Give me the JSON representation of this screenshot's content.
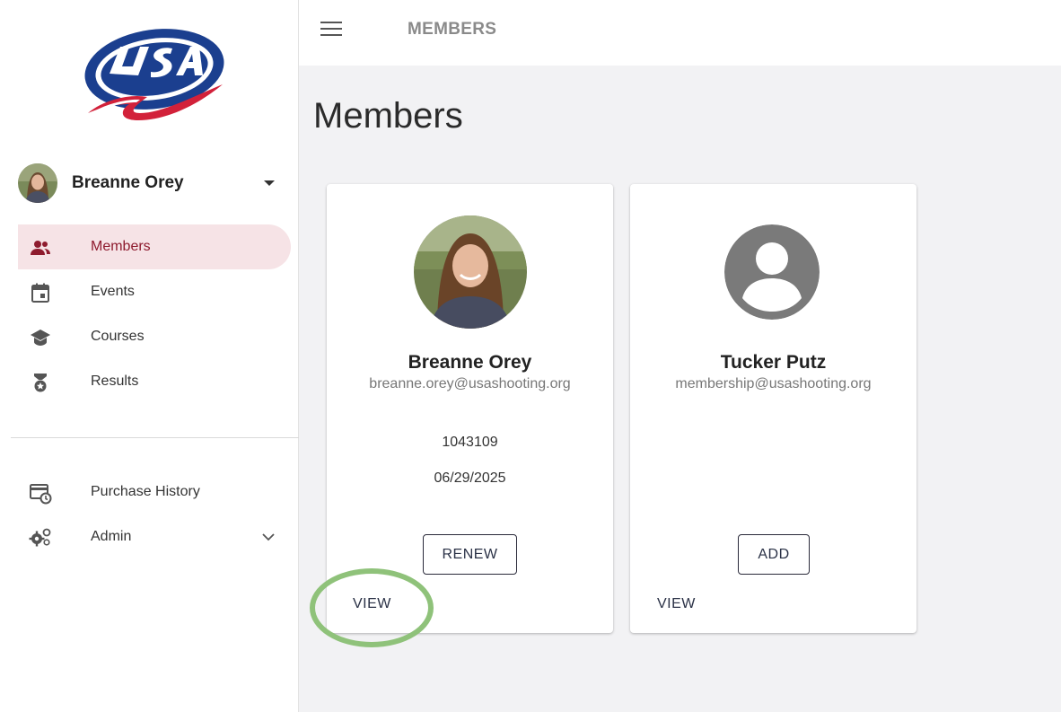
{
  "brand": {
    "logo_alt": "USA Shooting"
  },
  "user": {
    "name": "Breanne Orey"
  },
  "sidebar": {
    "items": [
      {
        "label": "Members",
        "icon": "people-icon",
        "active": true
      },
      {
        "label": "Events",
        "icon": "calendar-icon"
      },
      {
        "label": "Courses",
        "icon": "graduation-cap-icon"
      },
      {
        "label": "Results",
        "icon": "medal-icon"
      }
    ],
    "secondary": [
      {
        "label": "Purchase History",
        "icon": "purchase-history-icon"
      },
      {
        "label": "Admin",
        "icon": "gears-icon"
      }
    ]
  },
  "topbar": {
    "title": "MEMBERS"
  },
  "page": {
    "title": "Members"
  },
  "members": [
    {
      "name": "Breanne Orey",
      "email": "breanne.orey@usashooting.org",
      "member_id": "1043109",
      "expiration": "06/29/2025",
      "primary_action": "RENEW",
      "secondary_action": "VIEW"
    },
    {
      "name": "Tucker Putz",
      "email": "membership@usashooting.org",
      "primary_action": "ADD",
      "secondary_action": "VIEW"
    }
  ],
  "colors": {
    "accent": "#8e1b2e",
    "active_bg": "#f6e3e6",
    "highlight_ring": "#8fc27a",
    "page_bg": "#f2f2f4"
  }
}
